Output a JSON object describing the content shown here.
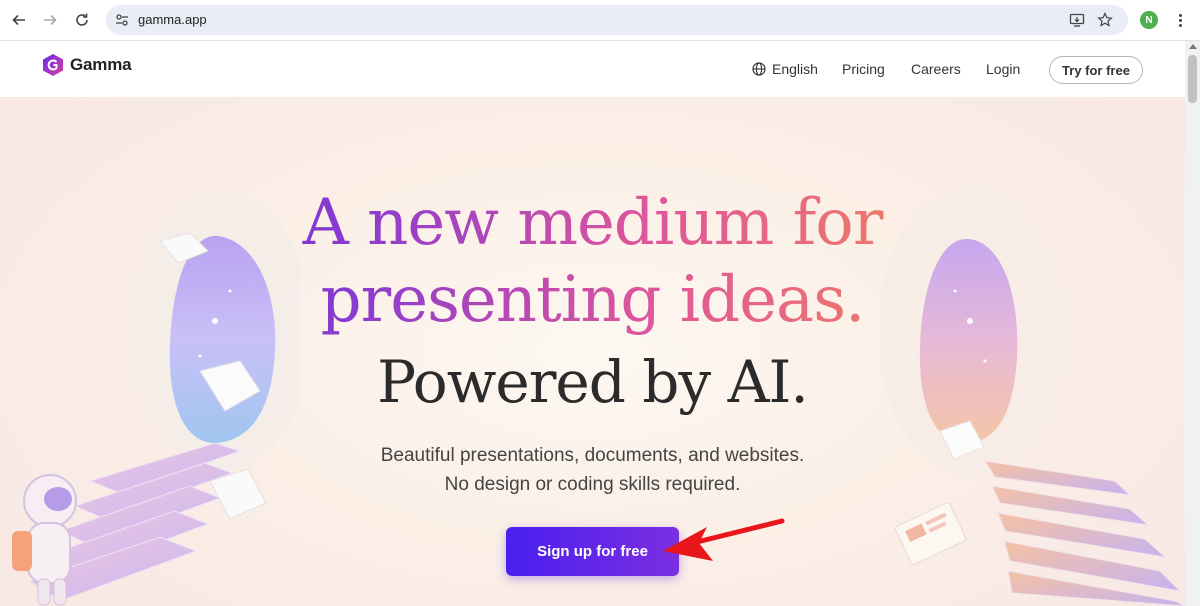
{
  "browser": {
    "url": "gamma.app",
    "profile_initial": "N",
    "icons": [
      "back-arrow",
      "forward-arrow",
      "reload",
      "site-settings",
      "install-app",
      "bookmark-star",
      "profile-avatar",
      "more-menu"
    ]
  },
  "header": {
    "logo_text": "Gamma",
    "language": "English",
    "nav": [
      "Pricing",
      "Careers",
      "Login"
    ],
    "try_button": "Try for free"
  },
  "hero": {
    "line1": "A new medium for",
    "line2": "presenting ideas.",
    "line3": "Powered by AI.",
    "subtitle1": "Beautiful presentations, documents, and websites.",
    "subtitle2": "No design or coding skills required.",
    "cta": "Sign up for free"
  },
  "colors": {
    "cta_start": "#4a1ff0",
    "cta_end": "#7b2fe0",
    "headline_dark": "#2b2b2b",
    "annotation_arrow": "#e8161b"
  }
}
